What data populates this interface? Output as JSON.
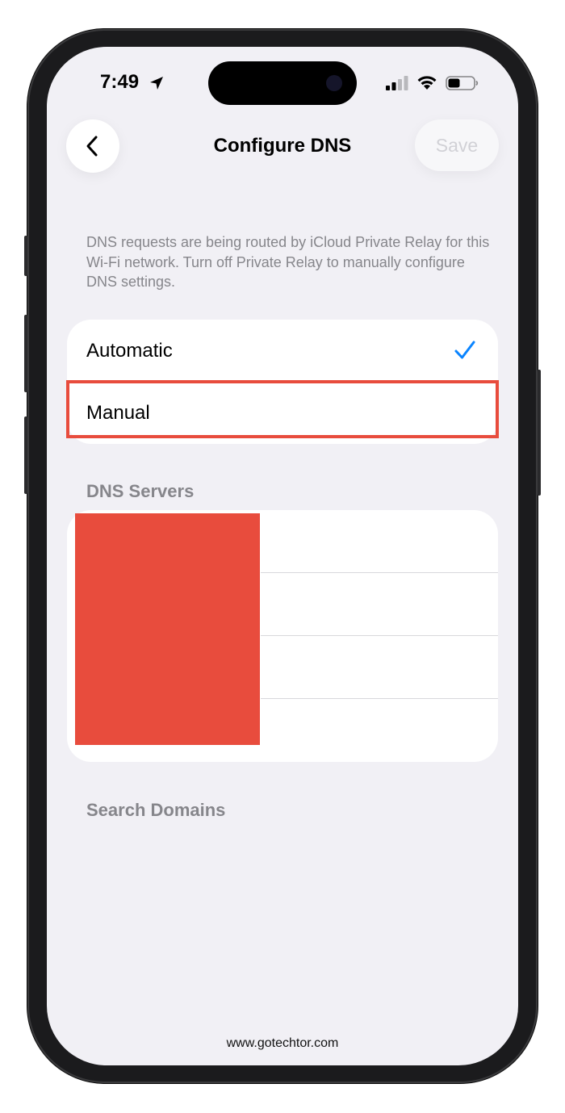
{
  "status_bar": {
    "time": "7:49",
    "location_icon": "location-arrow-icon",
    "signal_icon": "cellular-signal-icon",
    "wifi_icon": "wifi-icon",
    "battery_icon": "battery-icon"
  },
  "nav": {
    "back_icon": "chevron-left-icon",
    "title": "Configure DNS",
    "save_label": "Save"
  },
  "note": "DNS requests are being routed by iCloud Private Relay for this Wi-Fi network. Turn off Private Relay to manually configure DNS settings.",
  "mode_options": [
    {
      "label": "Automatic",
      "selected": true
    },
    {
      "label": "Manual",
      "selected": false
    }
  ],
  "dns_servers": {
    "header": "DNS Servers"
  },
  "search_domains": {
    "header": "Search Domains"
  },
  "footer": "www.gotechtor.com",
  "colors": {
    "accent": "#0a84ff",
    "annotation": "#e84c3d",
    "background": "#f1f0f5"
  }
}
